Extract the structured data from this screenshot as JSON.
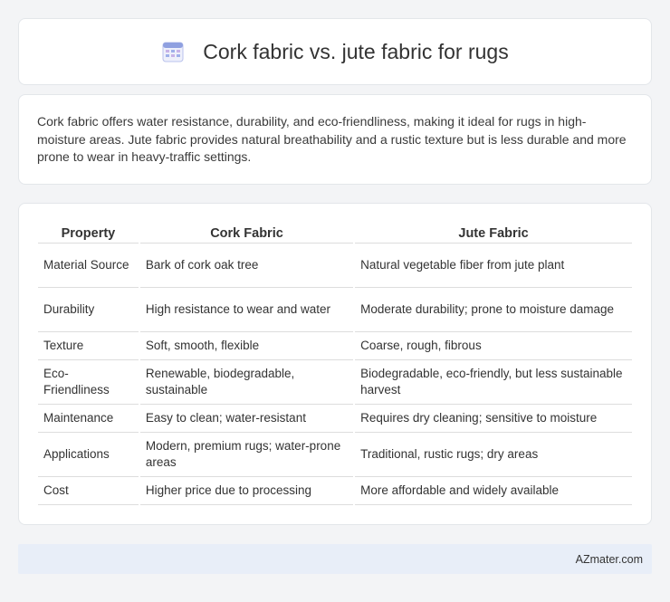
{
  "header": {
    "title": "Cork fabric vs. jute fabric for rugs",
    "icon": "calendar-grid-icon"
  },
  "summary": {
    "text": "Cork fabric offers water resistance, durability, and eco-friendliness, making it ideal for rugs in high-moisture areas. Jute fabric provides natural breathability and a rustic texture but is less durable and more prone to wear in heavy-traffic settings."
  },
  "table": {
    "headers": [
      "Property",
      "Cork Fabric",
      "Jute Fabric"
    ],
    "rows": [
      [
        "Material Source",
        "Bark of cork oak tree",
        "Natural vegetable fiber from jute plant"
      ],
      [
        "Durability",
        "High resistance to wear and water",
        "Moderate durability; prone to moisture damage"
      ],
      [
        "Texture",
        "Soft, smooth, flexible",
        "Coarse, rough, fibrous"
      ],
      [
        "Eco-Friendliness",
        "Renewable, biodegradable, sustainable",
        "Biodegradable, eco-friendly, but less sustainable harvest"
      ],
      [
        "Maintenance",
        "Easy to clean; water-resistant",
        "Requires dry cleaning; sensitive to moisture"
      ],
      [
        "Applications",
        "Modern, premium rugs; water-prone areas",
        "Traditional, rustic rugs; dry areas"
      ],
      [
        "Cost",
        "Higher price due to processing",
        "More affordable and widely available"
      ]
    ]
  },
  "footer": {
    "text": "AZmater.com"
  },
  "colors": {
    "background": "#f3f4f6",
    "card": "#ffffff",
    "footer_bg": "#e8eef8",
    "icon_accent": "#7b8fd6"
  }
}
